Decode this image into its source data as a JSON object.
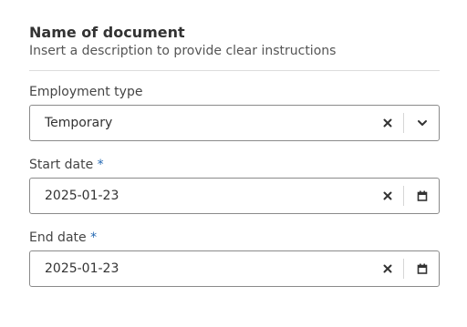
{
  "header": {
    "title": "Name of document",
    "description": "Insert a description to provide clear instructions"
  },
  "fields": {
    "employment_type": {
      "label": "Employment type",
      "value": "Temporary",
      "clear_icon": "close-icon",
      "dropdown_icon": "chevron-down-icon"
    },
    "start_date": {
      "label": "Start date",
      "required_marker": "*",
      "value": "2025-01-23",
      "clear_icon": "close-icon",
      "calendar_icon": "calendar-icon"
    },
    "end_date": {
      "label": "End date",
      "required_marker": "*",
      "value": "2025-01-23",
      "clear_icon": "close-icon",
      "calendar_icon": "calendar-icon"
    }
  },
  "colors": {
    "required_marker": "#2468b2",
    "border": "#8a8a8a",
    "divider": "#dcdcdc"
  }
}
